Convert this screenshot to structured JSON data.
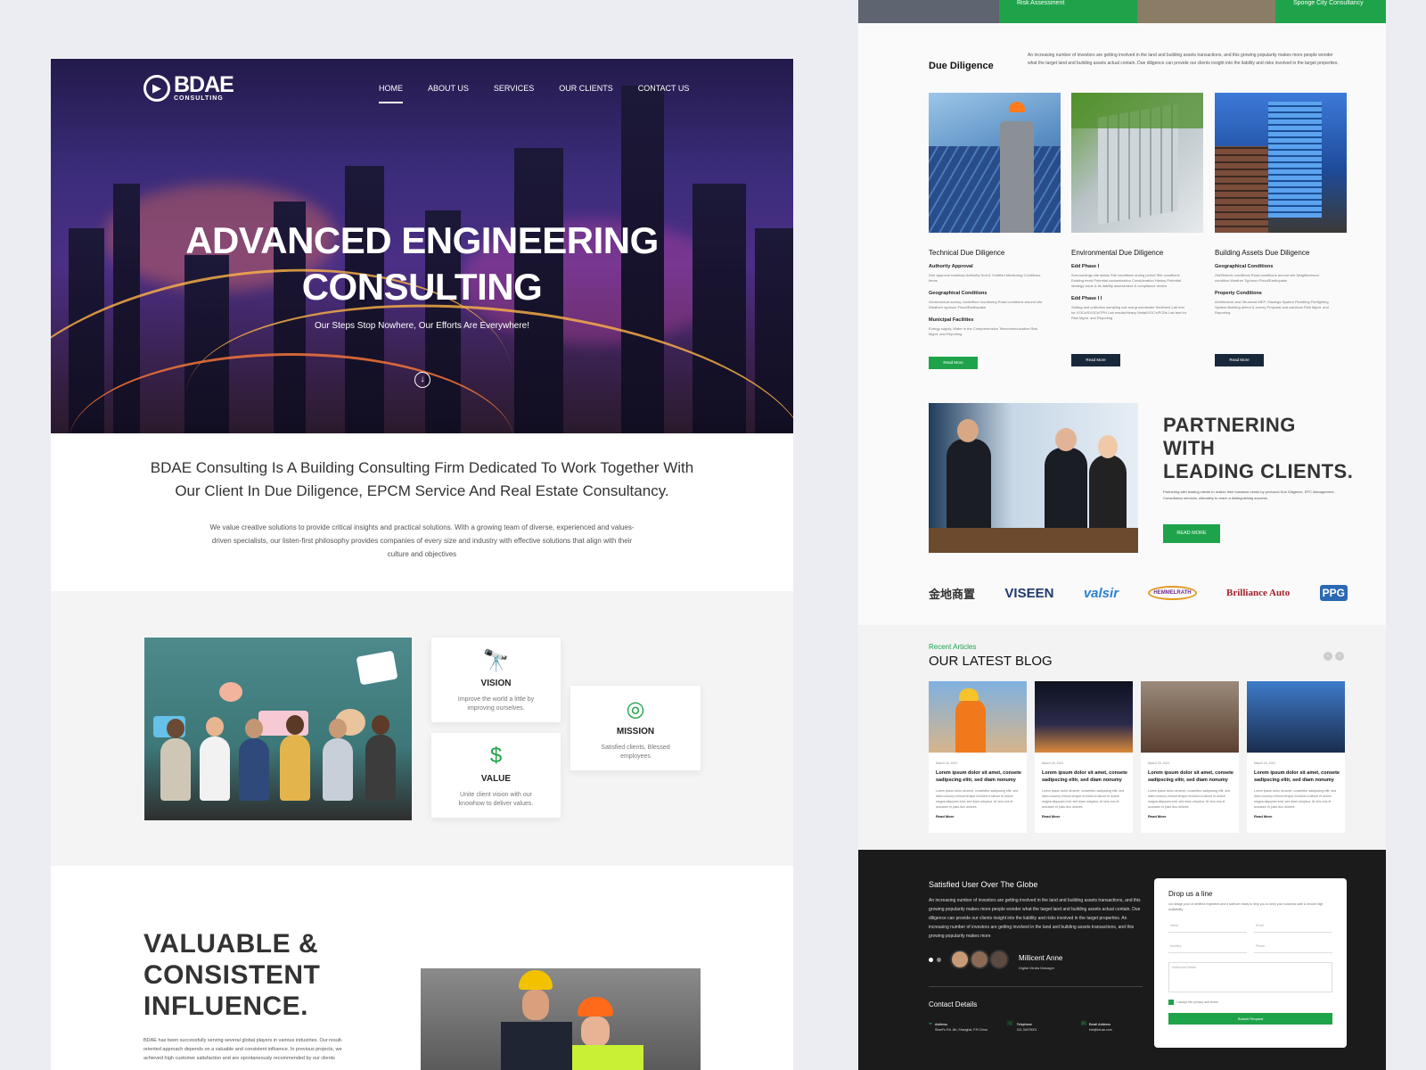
{
  "hero": {
    "logo_main": "BDAE",
    "logo_sub": "CONSULTING",
    "nav": [
      "HOME",
      "ABOUT US",
      "SERVICES",
      "OUR CLIENTS",
      "CONTACT US"
    ],
    "title_line1": "ADVANCED ENGINEERING",
    "title_line2": "CONSULTING",
    "subtitle": "Our Steps Stop Nowhere, Our Efforts Are Everywhere!"
  },
  "intro": {
    "heading": "BDAE Consulting Is A Building Consulting Firm Dedicated To Work Together With Our Client In Due Diligence, EPCM Service And Real Estate Consultancy.",
    "body": "We value creative solutions to provide critical insights and practical solutions. With a growing team of diverse, experienced and values-driven specialists, our listen-first philosophy provides companies of every size and industry with effective solutions that align with their culture and objectives"
  },
  "cards": {
    "vision_title": "VISION",
    "vision_text": "Improve the world a little by improving ourselves.",
    "mission_title": "MISSION",
    "mission_text": "Satisfied clients, Blessed employees",
    "value_title": "VALUE",
    "value_text": "Unite client vision with our knowhow to deliver values."
  },
  "influence": {
    "heading_1": "VALUABLE &",
    "heading_2": "CONSISTENT",
    "heading_3": "INFLUENCE.",
    "body": "BDAE has been successfully serving several global players in various industries. Our result-oriented approach depends on a valuable and consistent influence. In previous projects, we achieved high customer satisfaction and are spontaneously recommended by our clients"
  },
  "top_strip": {
    "item1": "Risk Assessment",
    "item2": "Sponge City Consultancy"
  },
  "due_diligence": {
    "title": "Due Diligence",
    "desc": "An increasing number of investors are getting involved in the land and building assets transactions, and this growing popularity makes more people wonder what the target land and building assets actual contain. Due diligence can provide our clients insight into the liability and risks involved in the target properties.",
    "columns": [
      {
        "title": "Technical Due Diligence",
        "sub1": "Authority Approval",
        "txt1": "Due approval roadmap Authority Nod & Certified Monitoring Conditions Items",
        "sub2": "Geographical Conditions",
        "txt2": "Geotechnical survey, Underfloor monitoring Road conditions around site Weather/ typhoon Flood/Earthquake",
        "sub3": "Municipal Facilities",
        "txt3": "Energy supply, Water in the Comprehension Telecommunication Risk Mgmt. and Reporting",
        "btn": "Read More"
      },
      {
        "title": "Environmental Due Diligence",
        "sub1": "Edd Phase Ⅰ",
        "txt1": "Surroundings site status Site conditions during period Site conditions Existing trend Potential contamination Consideration History Potential strategy Issue & its liability assessment & compliance review",
        "sub2": "Edd Phase Ⅰ Ⅰ",
        "txt2": "Setting and collection sampling soil and groundwater Sediment Lab test for VOCs/SVOCs/TPH Lab results/Heavy Metal/VOC's/PCBs Lab test for Risk Mgmt. and Reporting",
        "btn": "Read More"
      },
      {
        "title": "Building Assets Due Diligence",
        "sub1": "Geographical Conditions",
        "txt1": "Old/Historic conditions Road conditions around site Neighborhood condition Weather Typhoon Flood/Earthquake",
        "sub2": "Property Conditions",
        "txt2": "Architecture and Structural MEP, Glazings System Plumbing Firefighting System Building defect & survey Proposal and solutions Risk Mgmt. and Reporting",
        "btn": "Read More"
      }
    ]
  },
  "partner": {
    "heading_1": "PARTNERING",
    "heading_2": "WITH",
    "heading_3": "LEADING CLIENTS.",
    "body": "Partnering with leading clients to realize their business needs by profound Due Diligence, EPC Management, Consultancy services, ultimately to reach a distinguishing success.",
    "btn": "READ MORE",
    "logos": [
      "金地商置",
      "VISEEN",
      "valsir",
      "HEMMELRATH",
      "Brilliance Auto",
      "PPG"
    ]
  },
  "blog": {
    "label": "Recent Articles",
    "title": "OUR LATEST BLOG",
    "posts": [
      {
        "date": "March 15, 2021",
        "title": "Lorem ipsum dolor sit amet, consete sadipscing elitr, sed diam nonumy",
        "body": "Lorem ipsum dolor sit amet, consetetur sadipscing elitr, sed diam nonumy eirmod tempor invidunt ut labore et dolore magna aliquyam erat, sed diam voluptua. At vero eos et accusam et justo duo dolores",
        "more": "Read More"
      },
      {
        "date": "March 15, 2021",
        "title": "Lorem ipsum dolor sit amet, consete sadipscing elitr, sed diam nonumy",
        "body": "Lorem ipsum dolor sit amet, consetetur sadipscing elitr, sed diam nonumy eirmod tempor invidunt ut labore et dolore magna aliquyam erat, sed diam voluptua. At vero eos et accusam et justo duo dolores",
        "more": "Read More"
      },
      {
        "date": "March 15, 2021",
        "title": "Lorem ipsum dolor sit amet, consete sadipscing elitr, sed diam nonumy",
        "body": "Lorem ipsum dolor sit amet, consetetur sadipscing elitr, sed diam nonumy eirmod tempor invidunt ut labore et dolore magna aliquyam erat, sed diam voluptua. At vero eos et accusam et justo duo dolores",
        "more": "Read More"
      },
      {
        "date": "March 15, 2021",
        "title": "Lorem ipsum dolor sit amet, consete sadipscing elitr, sed diam nonumy",
        "body": "Lorem ipsum dolor sit amet, consetetur sadipscing elitr, sed diam nonumy eirmod tempor invidunt ut labore et dolore magna aliquyam erat, sed diam voluptua. At vero eos et accusam et justo duo dolores",
        "more": "Read More"
      }
    ]
  },
  "footer": {
    "title": "Satisfied User Over The Globe",
    "text": "An increasing number of investors are getting involved in the land and building assets transactions, and this growing popularity makes more people wonder what the target land and building assets actual contain. Due diligence can provide our clients insight into the liability and risks involved in the target properties. An increasing number of investors are getting involved in the land and building assets transactions, and this growing popularity makes more",
    "name": "Millicent Anne",
    "role": "Digital Media Manager",
    "contact_title": "Contact Details",
    "address_label": "Address",
    "address_value": "ShanFu Rd. 4th, Shanghai, P.R.China",
    "phone_label": "Telephone",
    "phone_value": "021-34079001",
    "email_label": "Email Address",
    "email_value": "info@bd-ae.com",
    "form_title": "Drop us a line",
    "form_desc": "our design pool of certified engineers and it staff are ready to help you to keep your business safe & ensure high availability.",
    "ph_name": "Name",
    "ph_email": "Email",
    "ph_industry": "Industry",
    "ph_phone": "Phone",
    "ph_details": "Additional Details",
    "agree": "I accept the privacy and terms",
    "submit": "Submit Request"
  },
  "colors": {
    "accent": "#1fa34a",
    "dark": "#1b1b1b",
    "navy": "#18283a"
  }
}
